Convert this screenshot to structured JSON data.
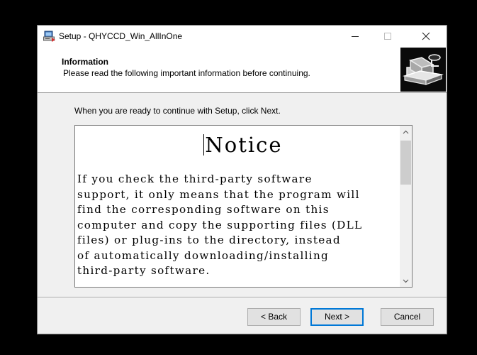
{
  "window": {
    "title": "Setup - QHYCCD_Win_AllInOne"
  },
  "header": {
    "title": "Information",
    "subtitle": "Please read the following important information before continuing."
  },
  "instruction": "When you are ready to continue with Setup, click Next.",
  "memo": {
    "heading": "Notice",
    "lines": [
      "If you check the third-party software",
      "support, it only means that the program will",
      "find the corresponding software on this",
      "computer and copy the supporting files (DLL",
      "files) or plug-ins to the directory, instead",
      "of automatically downloading/installing",
      "third-party software."
    ]
  },
  "buttons": {
    "back": "< Back",
    "next": "Next >",
    "cancel": "Cancel"
  },
  "icons": {
    "app": "setup-installer-icon",
    "header": "computer-install-icon",
    "minimize": "minimize-icon",
    "maximize": "maximize-icon",
    "close": "close-icon"
  },
  "colors": {
    "accent": "#0078d7"
  }
}
